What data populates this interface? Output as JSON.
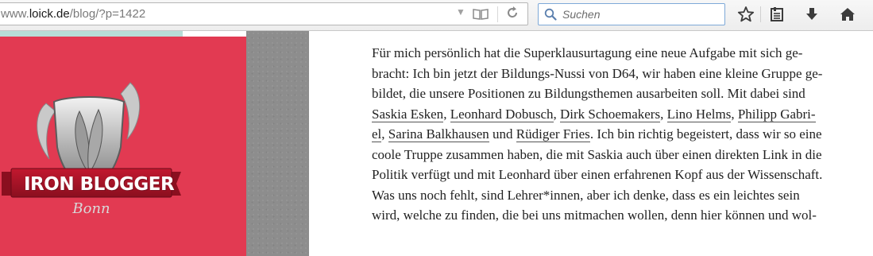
{
  "toolbar": {
    "url_prefix": "www.",
    "url_host": "loick.de",
    "url_path": "/blog/?p=1422",
    "search_placeholder": "Suchen"
  },
  "sidebar": {
    "logo_title": "IRON BLOGGER",
    "logo_subtitle": "Bonn",
    "accent_color": "#e23a52"
  },
  "article": {
    "l1": "Für mich persönlich hat die Superklausurtagung eine neue Aufgabe mit sich ge-",
    "l2": "bracht: Ich bin jetzt der Bildungs-Nussi von D64, wir haben eine kleine Gruppe ge-",
    "l3": "bildet, die unsere Positionen zu Bildungsthemen ausarbeiten soll. Mit dabei sind",
    "l4": {
      "link1": "Saskia Esken",
      "sep1": ", ",
      "link2": "Leonhard Dobusch",
      "sep2": ", ",
      "link3": "Dirk Schoemakers",
      "sep3": ", ",
      "link4": "Lino Helms",
      "sep4": ", ",
      "link5": "Philipp Gabri-"
    },
    "l5": {
      "link5_cont": "el",
      "sep1": ", ",
      "link6": "Sarina Balkhausen",
      "and": " und ",
      "link7": "Rüdiger Fries",
      "rest": ". Ich bin richtig begeistert, dass wir so eine"
    },
    "l6": "coole Truppe zusammen haben, die mit Saskia auch über einen direkten Link in die",
    "l7": "Politik verfügt und mit Leonhard über einen erfahrenen Kopf aus der Wissenschaft.",
    "l8": "Was uns noch fehlt, sind Lehrer*innen, aber ich denke, dass es ein leichtes sein",
    "l9": "wird, welche zu finden, die bei uns mitmachen wollen, denn hier können und wol-"
  },
  "icons": [
    "dropmarker-icon",
    "reader-view-icon",
    "reload-icon",
    "search-icon",
    "bookmark-star-icon",
    "bookmarks-list-icon",
    "download-icon",
    "home-icon"
  ]
}
